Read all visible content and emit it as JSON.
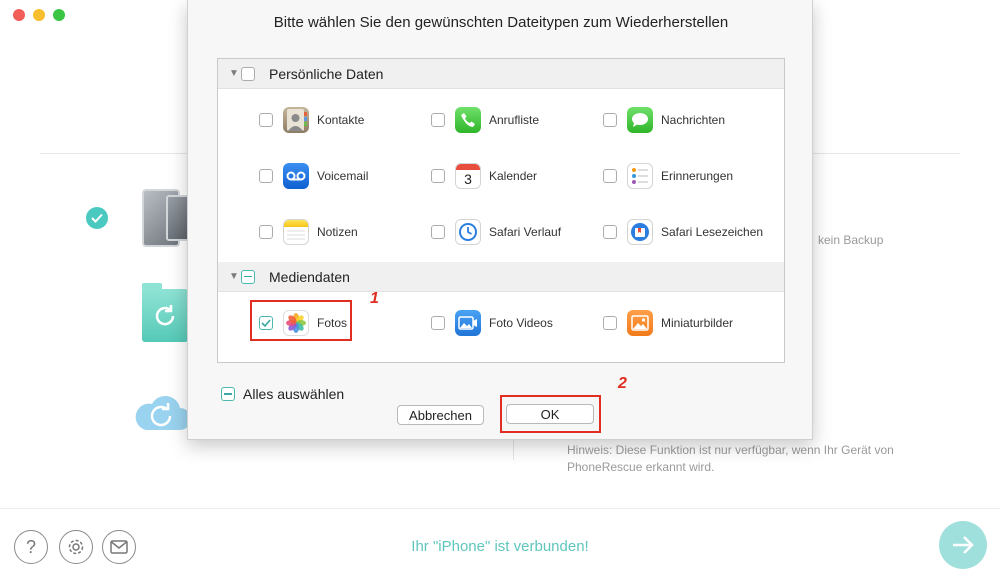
{
  "dialog": {
    "title": "Bitte wählen Sie den gewünschten Dateitypen zum Wiederherstellen",
    "sections": [
      {
        "label": "Persönliche Daten",
        "checked": false,
        "items": [
          "Kontakte",
          "Anrufliste",
          "Nachrichten",
          "Voicemail",
          "Kalender",
          "Erinnerungen",
          "Notizen",
          "Safari Verlauf",
          "Safari Lesezeichen"
        ]
      },
      {
        "label": "Mediendaten",
        "checked": "partial",
        "items": [
          "Fotos",
          "Foto Videos",
          "Miniaturbilder"
        ]
      }
    ],
    "calendar_day": "3",
    "select_all_label": "Alles auswählen",
    "cancel_label": "Abbrechen",
    "ok_label": "OK"
  },
  "annotations": {
    "step1": "1",
    "step2": "2"
  },
  "background": {
    "backup_text": "kein Backup",
    "hint_line1": "Hinweis: Diese Funktion ist nur verfügbar, wenn Ihr Gerät von",
    "hint_line2": "PhoneRescue erkannt wird.",
    "status": "Ihr \"iPhone\" ist verbunden!"
  },
  "colors": {
    "accent": "#5ec6bd",
    "annotation": "#e02e20"
  },
  "icons": {
    "footer": [
      "help-icon",
      "settings-icon",
      "mail-icon"
    ],
    "next": "arrow-right-icon"
  }
}
